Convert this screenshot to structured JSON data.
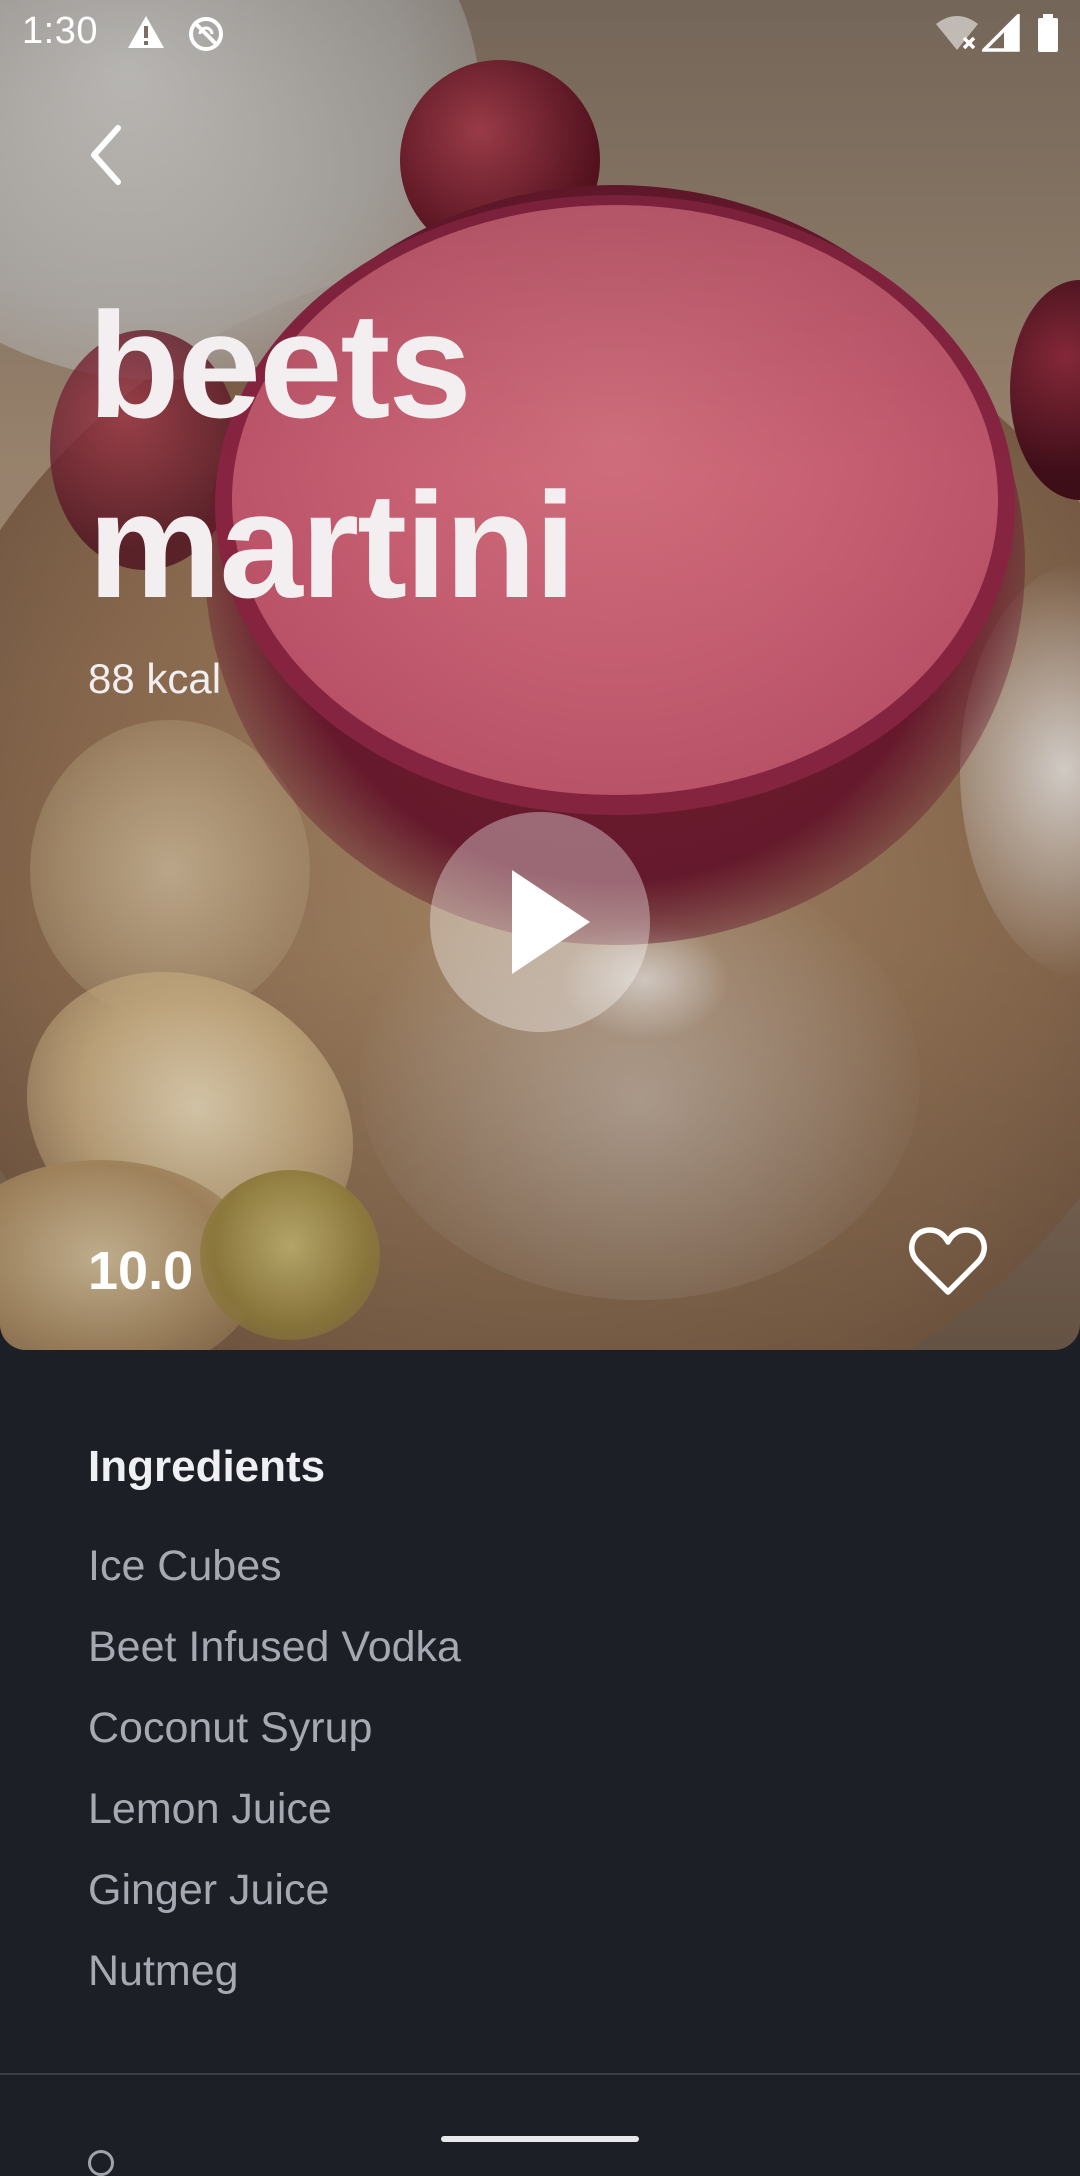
{
  "status_bar": {
    "time": "1:30",
    "left_icons": [
      "warning-icon",
      "sync-disabled-icon"
    ],
    "right_icons": [
      "wifi-off-icon",
      "signal-icon",
      "battery-icon"
    ]
  },
  "recipe": {
    "title_line1": "beets",
    "title_line2": "martini",
    "calories": "88 kcal",
    "rating": "10.0",
    "favorite": false
  },
  "ingredients": {
    "heading": "Ingredients",
    "items": [
      "Ice Cubes",
      "Beet Infused Vodka",
      "Coconut Syrup",
      "Lemon Juice",
      "Ginger Juice",
      "Nutmeg"
    ]
  },
  "colors": {
    "background": "#1d1f27",
    "title_text": "#f3eef0",
    "ingredient_text": "#a6a9b1"
  }
}
